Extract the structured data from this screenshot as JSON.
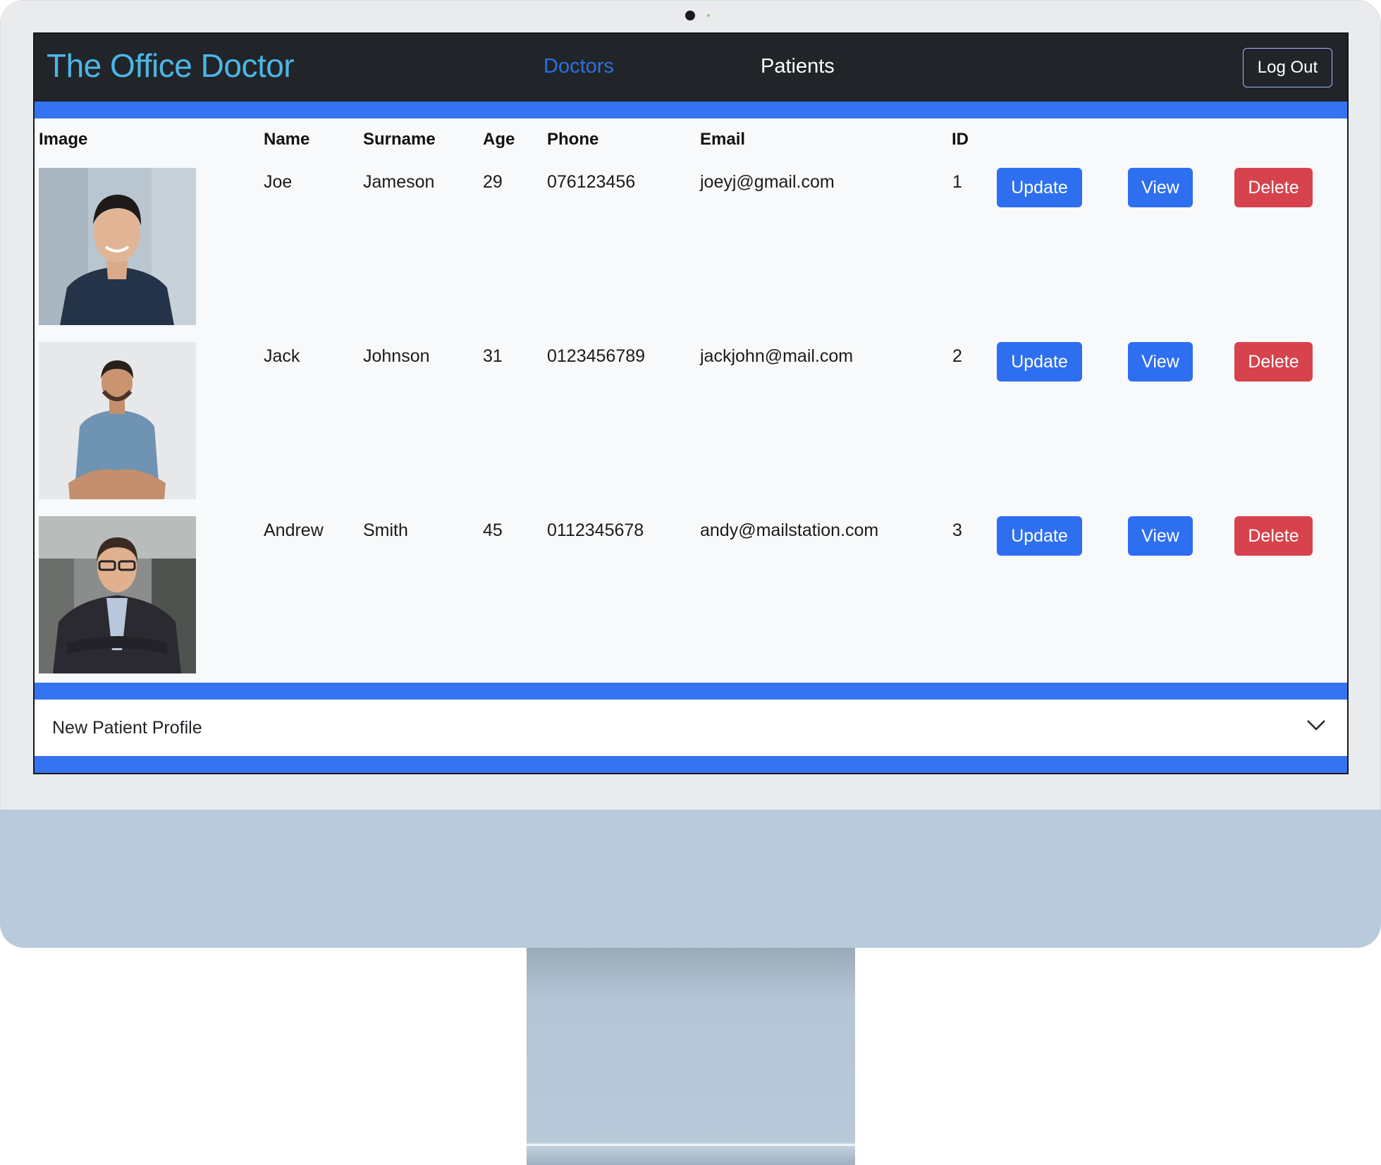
{
  "app": {
    "brand": "The Office Doctor"
  },
  "nav": {
    "links": [
      {
        "label": "Doctors",
        "active": true
      },
      {
        "label": "Patients",
        "active": false
      }
    ],
    "logout_label": "Log Out"
  },
  "table": {
    "headers": [
      "Image",
      "Name",
      "Surname",
      "Age",
      "Phone",
      "Email",
      "ID"
    ],
    "rows": [
      {
        "name": "Joe",
        "surname": "Jameson",
        "age": "29",
        "phone": "076123456",
        "email": "joeyj@gmail.com",
        "id": "1"
      },
      {
        "name": "Jack",
        "surname": "Johnson",
        "age": "31",
        "phone": "0123456789",
        "email": "jackjohn@mail.com",
        "id": "2"
      },
      {
        "name": "Andrew",
        "surname": "Smith",
        "age": "45",
        "phone": "0112345678",
        "email": "andy@mailstation.com",
        "id": "3"
      }
    ],
    "actions": {
      "update": "Update",
      "view": "View",
      "delete": "Delete"
    }
  },
  "accordion": {
    "title": "New Patient Profile",
    "icon": "chevron-down-icon"
  },
  "colors": {
    "brand": "#4cb6e6",
    "navbar": "#212529",
    "primary": "#2e6ff0",
    "danger": "#d7434c",
    "accent_bar": "#3573f0",
    "imac_chin": "#b8cadb"
  }
}
